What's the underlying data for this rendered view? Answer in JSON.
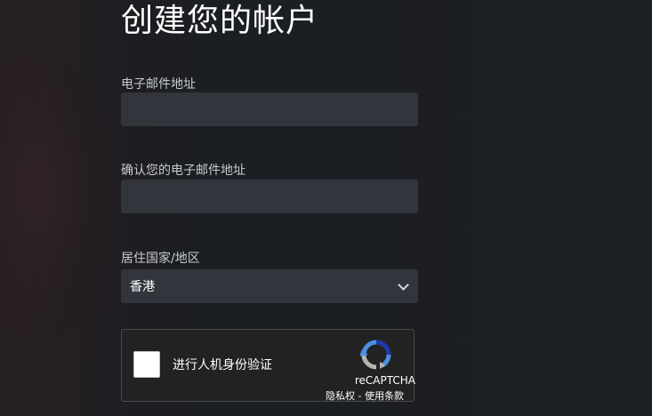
{
  "page": {
    "title": "创建您的帐户"
  },
  "form": {
    "email_label": "电子邮件地址",
    "email_value": "",
    "confirm_email_label": "确认您的电子邮件地址",
    "confirm_email_value": "",
    "country_label": "居住国家/地区",
    "country_selected": "香港"
  },
  "recaptcha": {
    "checkbox_label": "进行人机身份验证",
    "brand": "reCAPTCHA",
    "privacy_link": "隐私权",
    "separator": " - ",
    "terms_link": "使用条款",
    "logo_icon": "recaptcha-icon"
  },
  "colors": {
    "background": "#1b1e23",
    "input_background": "#32353c",
    "label_text": "#c6cbd2",
    "title_text": "#ffffff",
    "recaptcha_blue": "#4a90e2",
    "recaptcha_gray": "#b3b3b3"
  }
}
